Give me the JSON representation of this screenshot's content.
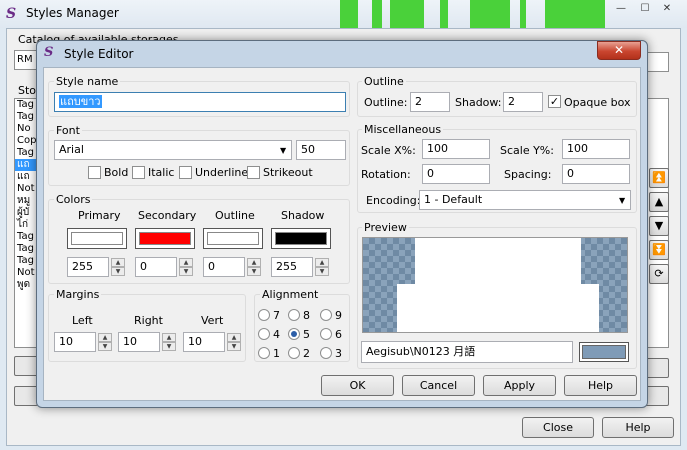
{
  "manager": {
    "title": "Styles Manager",
    "catalog_label": "Catalog of available storages",
    "catalog_value": "RM",
    "storage_label": "Sto",
    "storage_items": [
      "Tag",
      "Tag",
      "No",
      "Cop",
      "Tag",
      "แถ",
      "แถ",
      "Not",
      "หมู",
      "ผู้บั",
      "ไก่",
      "Tag",
      "Tag",
      "Tag",
      "Not",
      "พูด"
    ],
    "selected_index": 5,
    "close_label": "Close",
    "help_label": "Help"
  },
  "editor": {
    "title": "Style Editor",
    "style_name_label": "Style name",
    "style_name_value": "แถบขาว",
    "font": {
      "label": "Font",
      "family": "Arial",
      "size": "50",
      "bold_label": "Bold",
      "italic_label": "Italic",
      "underline_label": "Underline",
      "strikeout_label": "Strikeout"
    },
    "colors": {
      "label": "Colors",
      "primary_label": "Primary",
      "secondary_label": "Secondary",
      "outline_label": "Outline",
      "shadow_label": "Shadow",
      "primary_color": "#ffffff",
      "secondary_color": "#ff0000",
      "outline_color": "#ffffff",
      "shadow_color": "#000000",
      "primary_alpha": "255",
      "secondary_alpha": "0",
      "outline_alpha": "0",
      "shadow_alpha": "255"
    },
    "margins": {
      "label": "Margins",
      "left_label": "Left",
      "right_label": "Right",
      "vert_label": "Vert",
      "left": "10",
      "right": "10",
      "vert": "10"
    },
    "alignment": {
      "label": "Alignment",
      "options": [
        "7",
        "8",
        "9",
        "4",
        "5",
        "6",
        "1",
        "2",
        "3"
      ],
      "selected": "5"
    },
    "outline": {
      "label": "Outline",
      "outline_label": "Outline:",
      "outline_value": "2",
      "shadow_label": "Shadow:",
      "shadow_value": "2",
      "opaque_label": "Opaque box",
      "opaque_checked": true
    },
    "misc": {
      "label": "Miscellaneous",
      "scale_x_label": "Scale X%:",
      "scale_x": "100",
      "scale_y_label": "Scale Y%:",
      "scale_y": "100",
      "rotation_label": "Rotation:",
      "rotation": "0",
      "spacing_label": "Spacing:",
      "spacing": "0",
      "encoding_label": "Encoding:",
      "encoding": "1 - Default"
    },
    "preview": {
      "label": "Preview",
      "text": "Aegisub\\N0123 月語",
      "bg_color": "#7f9bb7"
    },
    "buttons": {
      "ok": "OK",
      "cancel": "Cancel",
      "apply": "Apply",
      "help": "Help"
    }
  }
}
